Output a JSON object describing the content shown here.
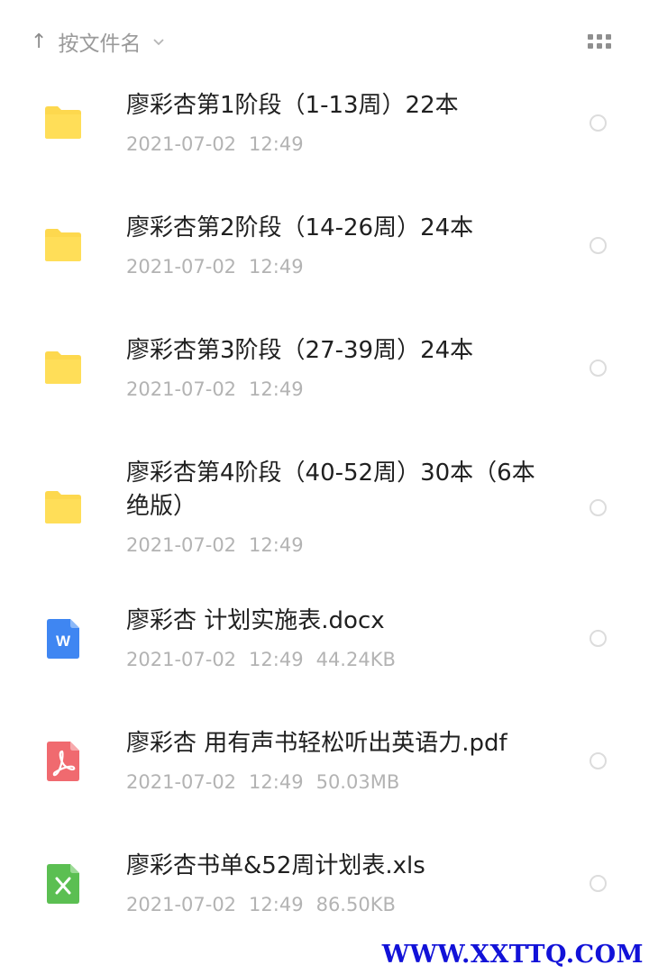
{
  "header": {
    "sort_label": "按文件名",
    "sort_arrow": "↑",
    "sort_chevron": "⌄"
  },
  "files": [
    {
      "type": "folder",
      "title": "廖彩杏第1阶段（1-13周）22本",
      "date": "2021-07-02",
      "time": "12:49",
      "size": ""
    },
    {
      "type": "folder",
      "title": "廖彩杏第2阶段（14-26周）24本",
      "date": "2021-07-02",
      "time": "12:49",
      "size": ""
    },
    {
      "type": "folder",
      "title": "廖彩杏第3阶段（27-39周）24本",
      "date": "2021-07-02",
      "time": "12:49",
      "size": ""
    },
    {
      "type": "folder",
      "title": "廖彩杏第4阶段（40-52周）30本（6本绝版）",
      "date": "2021-07-02",
      "time": "12:49",
      "size": ""
    },
    {
      "type": "docx",
      "title": "廖彩杏 计划实施表.docx",
      "date": "2021-07-02",
      "time": "12:49",
      "size": "44.24KB"
    },
    {
      "type": "pdf",
      "title": "廖彩杏 用有声书轻松听出英语力.pdf",
      "date": "2021-07-02",
      "time": "12:49",
      "size": "50.03MB"
    },
    {
      "type": "xls",
      "title": "廖彩杏书单&52周计划表.xls",
      "date": "2021-07-02",
      "time": "12:49",
      "size": "86.50KB"
    }
  ],
  "icons": {
    "folder": "folder-icon",
    "docx": "word-doc-icon",
    "pdf": "pdf-icon",
    "xls": "excel-sheet-icon",
    "word_letter": "W"
  },
  "colors": {
    "folder": "#fdd84e",
    "word": "#3f86f2",
    "pdf": "#f06a6f",
    "excel": "#5bbf52",
    "meta_text": "#b3b3b3",
    "watermark": "#1212d8"
  },
  "watermark": "WWW.XXTTQ.COM"
}
